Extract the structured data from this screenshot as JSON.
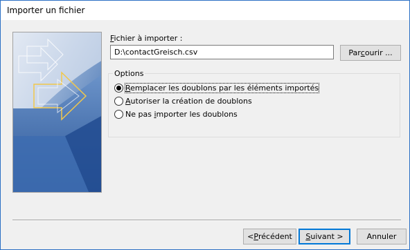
{
  "window": {
    "title": "Importer un fichier"
  },
  "file": {
    "label_accel": "F",
    "label_rest": "ichier à importer :",
    "value": "D:\\contactGreisch.csv",
    "browse_pre": "Par",
    "browse_accel": "c",
    "browse_post": "ourir ..."
  },
  "options": {
    "legend": "Options",
    "items": [
      {
        "pre": "",
        "accel": "R",
        "post": "emplacer les doublons par les éléments importés",
        "checked": true
      },
      {
        "pre": "",
        "accel": "A",
        "post": "utoriser la création de doublons",
        "checked": false
      },
      {
        "pre": "Ne pas ",
        "accel": "i",
        "post": "mporter les doublons",
        "checked": false
      }
    ]
  },
  "buttons": {
    "prev_pre": "< ",
    "prev_accel": "P",
    "prev_post": "récédent",
    "next_accel": "S",
    "next_post": "uivant >",
    "cancel": "Annuler"
  },
  "colors": {
    "accent": "#0078d7",
    "art_blue": "#4a7dbf"
  },
  "icons": {
    "wizard_art": "arrow-graphic-icon"
  }
}
